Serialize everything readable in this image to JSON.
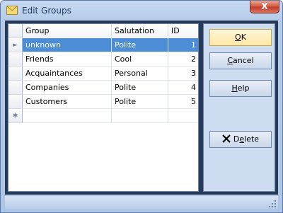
{
  "window": {
    "title": "Edit Groups",
    "close_label": "X"
  },
  "grid": {
    "columns": [
      "Group",
      "Salutation",
      "ID"
    ],
    "rows": [
      {
        "group": "unknown",
        "salutation": "Polite",
        "id": "1"
      },
      {
        "group": "Friends",
        "salutation": "Cool",
        "id": "2"
      },
      {
        "group": "Acquaintances",
        "salutation": "Personal",
        "id": "3"
      },
      {
        "group": "Companies",
        "salutation": "Polite",
        "id": "4"
      },
      {
        "group": "Customers",
        "salutation": "Polite",
        "id": "5"
      }
    ],
    "current_row_marker": "►",
    "new_row_marker": "✱"
  },
  "buttons": {
    "ok": {
      "pre": "",
      "u": "O",
      "post": "K"
    },
    "cancel": {
      "pre": "",
      "u": "C",
      "post": "ancel"
    },
    "help": {
      "pre": "",
      "u": "H",
      "post": "elp"
    },
    "delete": {
      "pre": "D",
      "u": "e",
      "post": "lete"
    }
  },
  "colors": {
    "selection": "#4c8dd6",
    "client_bg": "#283a5a",
    "title_text": "#1e3a5f"
  }
}
